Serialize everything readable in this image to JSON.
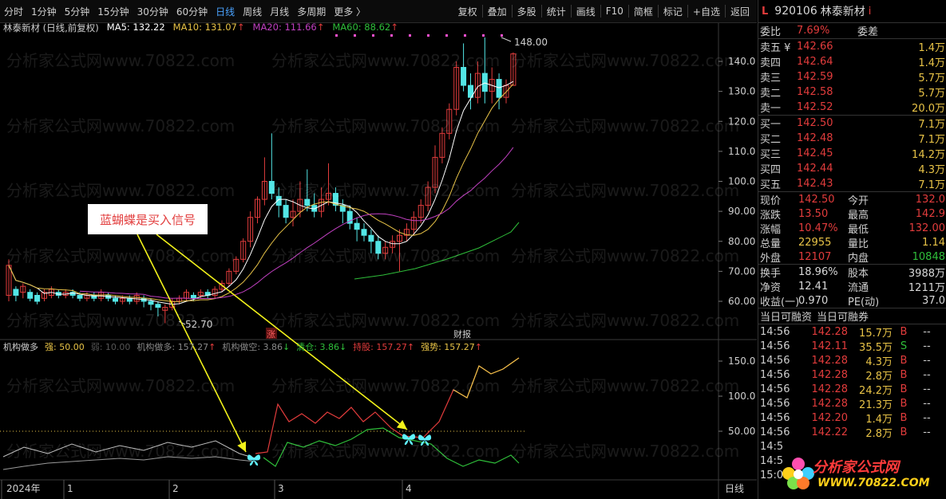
{
  "toolbar": {
    "periods": [
      "分时",
      "1分钟",
      "5分钟",
      "15分钟",
      "30分钟",
      "60分钟",
      "日线",
      "周线",
      "月线",
      "多周期",
      "更多 〉"
    ],
    "active_period": "日线",
    "tools": [
      "复权",
      "叠加",
      "多股",
      "统计",
      "画线",
      "F10",
      "简框",
      "标记",
      "+自选",
      "返回"
    ]
  },
  "chart_header": {
    "stock": "林泰新材 (日线,前复权)",
    "ma5": "MA5: 132.22",
    "ma10": "MA10: 131.07",
    "ma20": "MA20: 111.66",
    "ma60": "MA60: 88.62",
    "up_arrow": "↑",
    "high_label": "148.00",
    "low_label": "52.70",
    "zhang_label": "涨",
    "caibao_label": "财报"
  },
  "price_axis": [
    "140.0",
    "130.0",
    "120.0",
    "110.0",
    "100.0",
    "90.00",
    "80.00",
    "70.00",
    "60.00"
  ],
  "indicator_header": {
    "name": "机构做多",
    "strong": "强: 50.00",
    "weak": "弱: 10.00",
    "inst_long": "机构做多: 157.27",
    "inst_empty": "机构做空: 3.86",
    "clear": "清仓: 3.86",
    "hold": "持股: 157.27",
    "strong_trend": "强势: 157.27",
    "up_arrow": "↑",
    "down_arrow": "↓"
  },
  "indicator_axis": [
    "150.0",
    "100.0",
    "50.00"
  ],
  "time_axis": [
    "2024年",
    "1",
    "2",
    "3",
    "4"
  ],
  "period_label": "日线",
  "callout": "蓝蝴蝶是买入信号",
  "watermark": "分析家公式网www.70822.com",
  "panel": {
    "mark": "L",
    "code": "920106",
    "name": "林泰新材",
    "info_icon": "i",
    "ratio": {
      "label": "委比",
      "value": "7.69%",
      "label2": "委差"
    },
    "asks": [
      {
        "label": "卖五 ¥",
        "price": "142.66",
        "vol": "1.4万"
      },
      {
        "label": "卖四",
        "price": "142.64",
        "vol": "1.4万"
      },
      {
        "label": "卖三",
        "price": "142.59",
        "vol": "5.7万"
      },
      {
        "label": "卖二",
        "price": "142.58",
        "vol": "5.7万"
      },
      {
        "label": "卖一",
        "price": "142.52",
        "vol": "20.0万"
      }
    ],
    "bids": [
      {
        "label": "买一",
        "price": "142.50",
        "vol": "7.1万"
      },
      {
        "label": "买二",
        "price": "142.48",
        "vol": "7.1万"
      },
      {
        "label": "买三",
        "price": "142.45",
        "vol": "14.2万"
      },
      {
        "label": "买四",
        "price": "142.44",
        "vol": "4.3万"
      },
      {
        "label": "买五",
        "price": "142.43",
        "vol": "7.1万"
      }
    ],
    "quote": [
      {
        "l1": "现价",
        "v1": "142.50",
        "l2": "今开",
        "v2": "132.0"
      },
      {
        "l1": "涨跌",
        "v1": "13.50",
        "l2": "最高",
        "v2": "142.9"
      },
      {
        "l1": "涨幅",
        "v1": "10.47%",
        "l2": "最低",
        "v2": "132.00"
      },
      {
        "l1": "总量",
        "v1": "22955",
        "l2": "量比",
        "v2": "1.14"
      },
      {
        "l1": "外盘",
        "v1": "12107",
        "l2": "内盘",
        "v2": "10848"
      }
    ],
    "stats": [
      {
        "l1": "换手",
        "v1": "18.96%",
        "l2": "股本",
        "v2": "3988万"
      },
      {
        "l1": "净资",
        "v1": "12.41",
        "l2": "流通",
        "v2": "1211万"
      },
      {
        "l1": "收益(一)",
        "v1": "0.970",
        "l2": "PE(动)",
        "v2": "37.0"
      }
    ],
    "margin_tabs": [
      "当日可融资",
      "当日可融券"
    ],
    "ticks": [
      {
        "t": "14:56",
        "p": "142.28",
        "v": "15.7万",
        "bs": "B",
        "d": "--"
      },
      {
        "t": "14:56",
        "p": "142.11",
        "v": "35.5万",
        "bs": "S",
        "d": "--"
      },
      {
        "t": "14:56",
        "p": "142.28",
        "v": "4.3万",
        "bs": "B",
        "d": "--"
      },
      {
        "t": "14:56",
        "p": "142.28",
        "v": "2.8万",
        "bs": "B",
        "d": "--"
      },
      {
        "t": "14:56",
        "p": "142.28",
        "v": "24.2万",
        "bs": "B",
        "d": "--"
      },
      {
        "t": "14:56",
        "p": "142.28",
        "v": "21.3万",
        "bs": "B",
        "d": "--"
      },
      {
        "t": "14:56",
        "p": "142.20",
        "v": "1.4万",
        "bs": "B",
        "d": "--"
      },
      {
        "t": "14:56",
        "p": "142.22",
        "v": "2.8万",
        "bs": "B",
        "d": "--"
      },
      {
        "t": "14:5",
        "p": "",
        "v": "",
        "bs": "",
        "d": ""
      },
      {
        "t": "14:5",
        "p": "",
        "v": "",
        "bs": "",
        "d": ""
      },
      {
        "t": "15:0",
        "p": "",
        "v": "",
        "bs": "",
        "d": ""
      }
    ]
  },
  "logo": {
    "title": "分析家公式网",
    "url": "WWW.70822.COM"
  },
  "colors": {
    "up": "#e23c3c",
    "down": "#53e6e6",
    "ma5": "#ffffff",
    "ma10": "#e8c347",
    "ma20": "#c040c0",
    "ma60": "#2fbf3a",
    "accent": "#4aa3ff"
  }
}
